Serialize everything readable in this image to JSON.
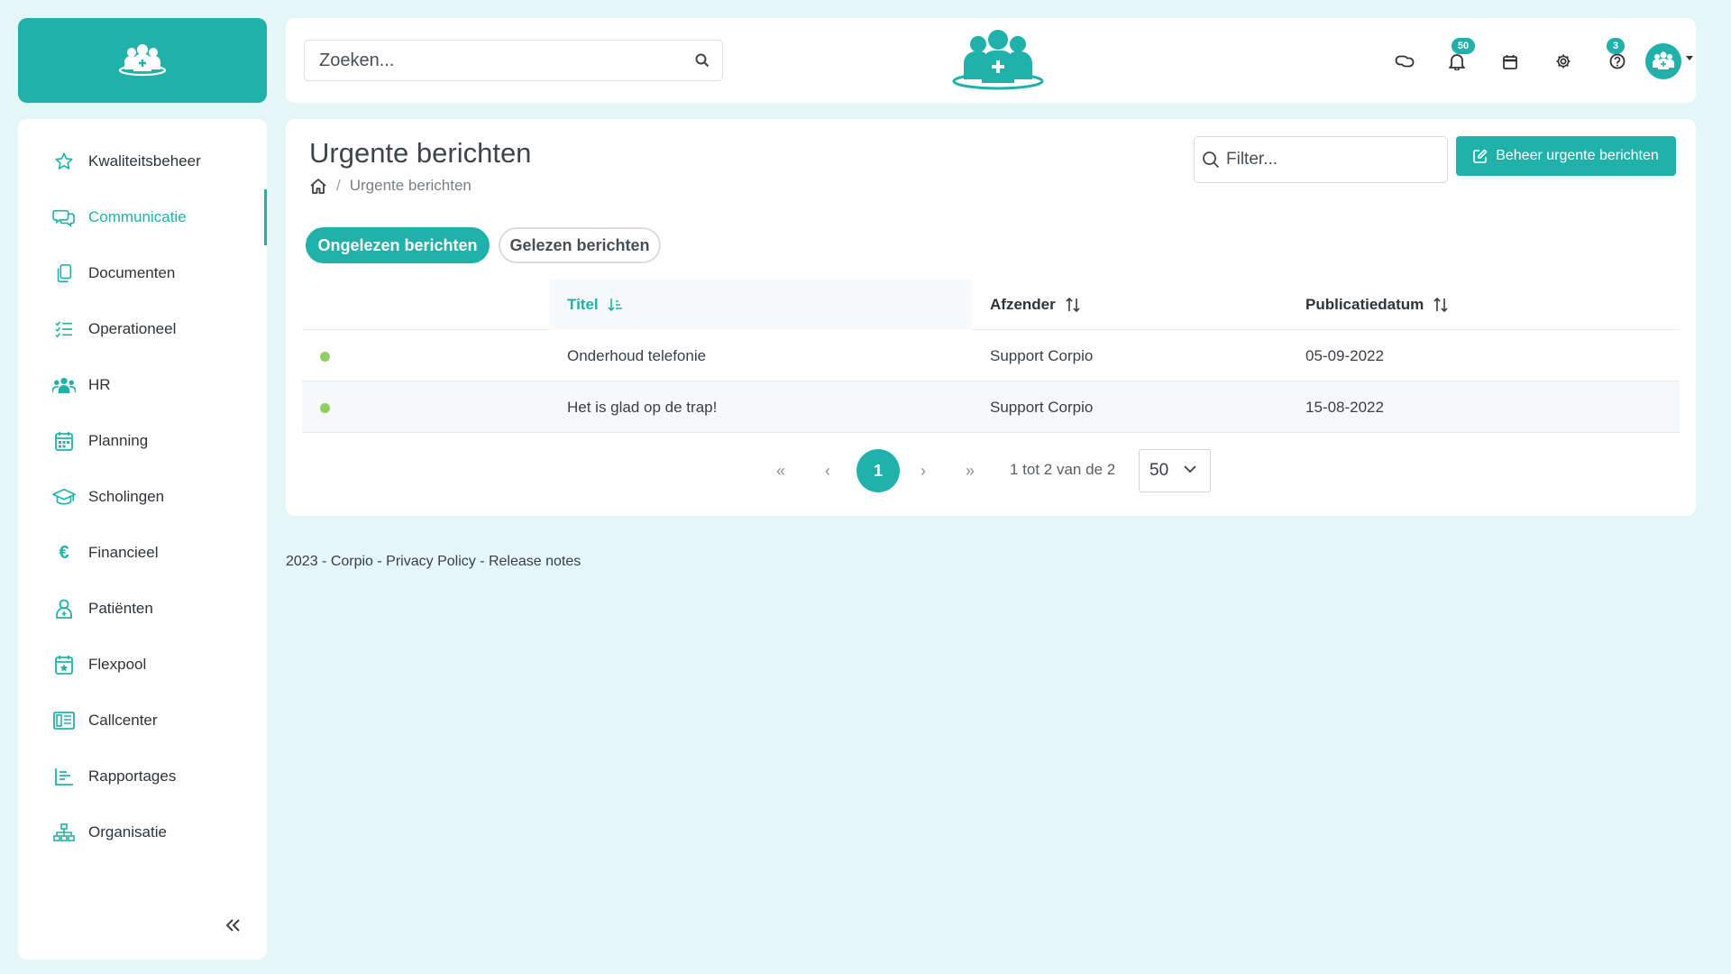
{
  "colors": {
    "accent": "#20b2aa",
    "background": "#e4f7f6",
    "unread_dot": "#8fcf5f"
  },
  "header": {
    "search_placeholder": "Zoeken...",
    "notifications_badge": "50",
    "help_badge": "3",
    "icons": [
      "link-icon",
      "bell-icon",
      "calendar-icon",
      "gear-icon",
      "help-icon"
    ]
  },
  "sidebar": {
    "items": [
      {
        "label": "Kwaliteitsbeheer",
        "icon": "star-icon"
      },
      {
        "label": "Communicatie",
        "icon": "chat-icon",
        "active": true
      },
      {
        "label": "Documenten",
        "icon": "documents-icon"
      },
      {
        "label": "Operationeel",
        "icon": "checklist-icon"
      },
      {
        "label": "HR",
        "icon": "people-icon"
      },
      {
        "label": "Planning",
        "icon": "calendar-grid-icon"
      },
      {
        "label": "Scholingen",
        "icon": "graduation-cap-icon"
      },
      {
        "label": "Financieel",
        "icon": "euro-icon"
      },
      {
        "label": "Patiënten",
        "icon": "patient-icon"
      },
      {
        "label": "Flexpool",
        "icon": "calendar-star-icon"
      },
      {
        "label": "Callcenter",
        "icon": "callcenter-icon"
      },
      {
        "label": "Rapportages",
        "icon": "report-icon"
      },
      {
        "label": "Organisatie",
        "icon": "org-chart-icon"
      }
    ],
    "collapse_icon": "«"
  },
  "main": {
    "title": "Urgente berichten",
    "breadcrumb_current": "Urgente berichten",
    "filter_placeholder": "Filter...",
    "manage_button": "Beheer urgente berichten",
    "tabs": [
      {
        "label": "Ongelezen berichten",
        "active": true
      },
      {
        "label": "Gelezen berichten",
        "active": false
      }
    ],
    "table": {
      "columns": [
        "Titel",
        "Afzender",
        "Publicatiedatum"
      ],
      "rows": [
        {
          "title": "Onderhoud telefonie",
          "sender": "Support Corpio",
          "date": "05-09-2022",
          "unread": true
        },
        {
          "title": "Het is glad op de trap!",
          "sender": "Support Corpio",
          "date": "15-08-2022",
          "unread": true
        }
      ]
    },
    "pagination": {
      "first": "«",
      "prev": "‹",
      "current": "1",
      "next": "›",
      "last": "»",
      "info": "1 tot 2 van de 2",
      "page_size": "50"
    }
  },
  "footer": {
    "year_brand": "2023 - Corpio",
    "sep1": " - ",
    "privacy": "Privacy Policy",
    "sep2": " - ",
    "release_notes": "Release notes"
  }
}
